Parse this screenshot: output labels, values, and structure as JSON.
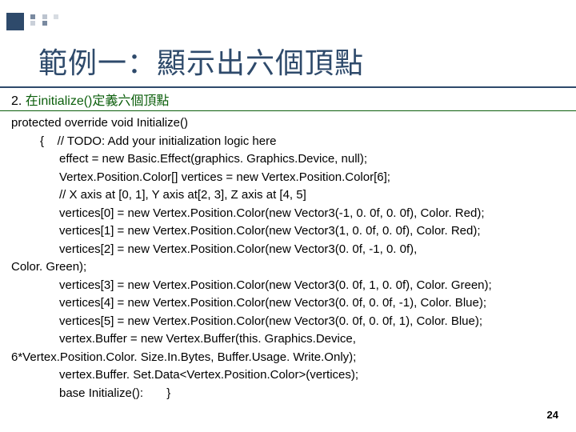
{
  "title": "範例一：顯示出六個頂點",
  "subtitle_num": "2. ",
  "subtitle_txt": "在initialize()定義六個頂點",
  "code": {
    "l0": "protected override void Initialize()",
    "l1": "{    // TODO: Add your initialization logic here",
    "l2": "effect = new Basic.Effect(graphics. Graphics.Device, null);",
    "l3": "Vertex.Position.Color[] vertices = new Vertex.Position.Color[6];",
    "l4": "// X axis at [0, 1], Y axis at[2, 3], Z axis at [4, 5]",
    "l5": "vertices[0] = new Vertex.Position.Color(new Vector3(-1, 0. 0f, 0. 0f), Color. Red);",
    "l6": "vertices[1] = new Vertex.Position.Color(new Vector3(1, 0. 0f, 0. 0f), Color. Red);",
    "l7a": "vertices[2] = new Vertex.Position.Color(new Vector3(0. 0f, -1, 0. 0f),",
    "l7b": "Color. Green);",
    "l8": "vertices[3] = new Vertex.Position.Color(new Vector3(0. 0f, 1, 0. 0f), Color. Green);",
    "l9": "vertices[4] = new Vertex.Position.Color(new Vector3(0. 0f, 0. 0f, -1), Color. Blue);",
    "l10": "vertices[5] = new Vertex.Position.Color(new Vector3(0. 0f, 0. 0f, 1), Color. Blue);",
    "l11": "vertex.Buffer = new Vertex.Buffer(this. Graphics.Device,",
    "l12": "6*Vertex.Position.Color. Size.In.Bytes, Buffer.Usage. Write.Only);",
    "l13": "vertex.Buffer. Set.Data<Vertex.Position.Color>(vertices);",
    "l14": "base Initialize():       }"
  },
  "pagenum": "24"
}
